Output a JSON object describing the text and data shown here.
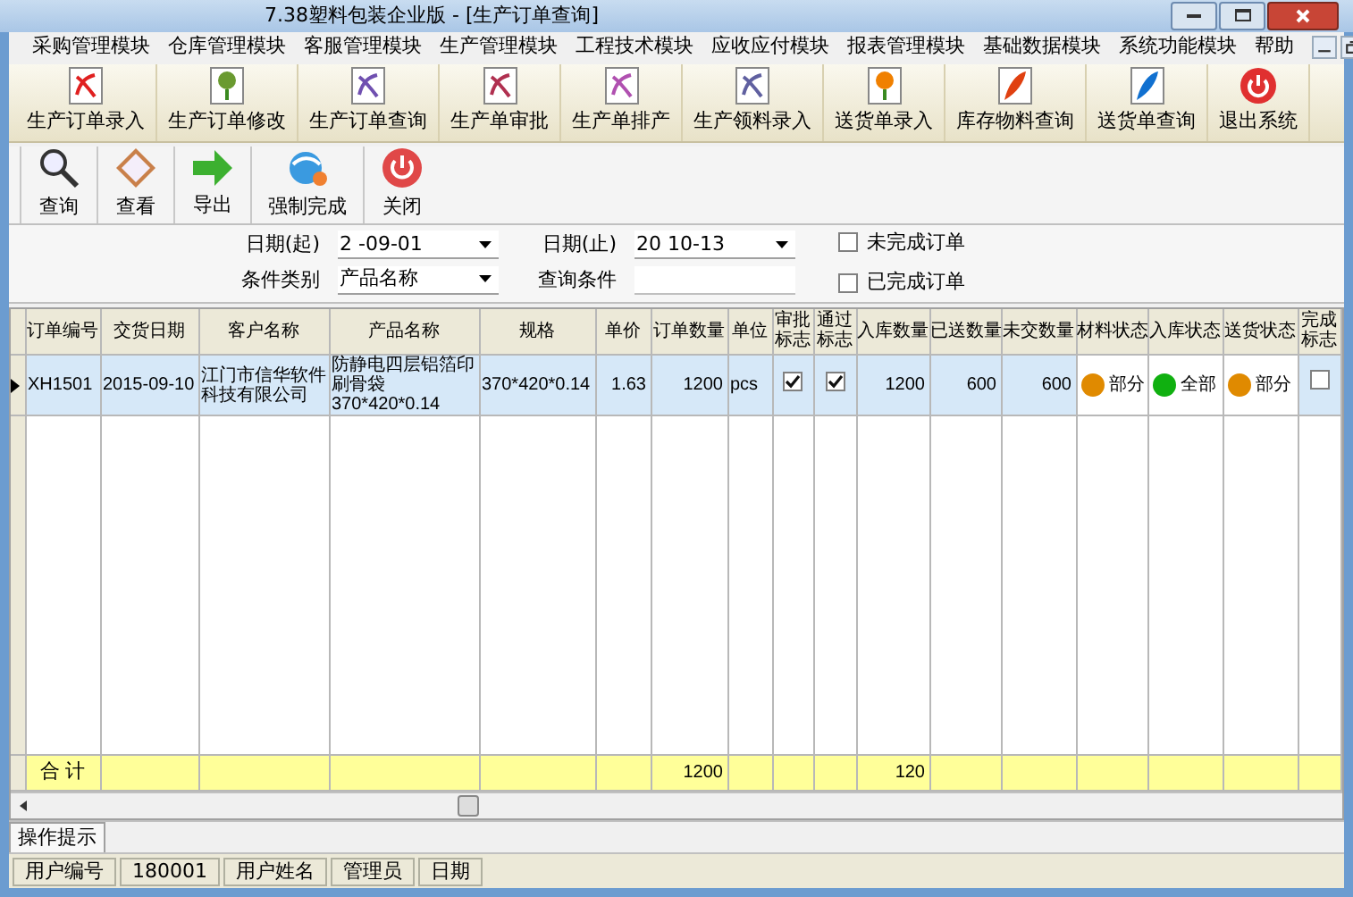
{
  "window": {
    "title": "7.38塑料包装企业版 - [生产订单查询]"
  },
  "menu": [
    {
      "label": "采购管理模块"
    },
    {
      "label": "仓库管理模块"
    },
    {
      "label": "客服管理模块"
    },
    {
      "label": "生产管理模块"
    },
    {
      "label": "工程技术模块"
    },
    {
      "label": "应收应付模块"
    },
    {
      "label": "报表管理模块"
    },
    {
      "label": "基础数据模块"
    },
    {
      "label": "系统功能模块"
    },
    {
      "label": "帮助"
    }
  ],
  "module_toolbar": [
    {
      "label": "生产订单录入"
    },
    {
      "label": "生产订单修改"
    },
    {
      "label": "生产订单查询"
    },
    {
      "label": "生产单审批"
    },
    {
      "label": "生产单排产"
    },
    {
      "label": "生产领料录入"
    },
    {
      "label": "送货单录入"
    },
    {
      "label": "库存物料查询"
    },
    {
      "label": "送货单查询"
    },
    {
      "label": "退出系统"
    }
  ],
  "action_toolbar": [
    {
      "label": "查询"
    },
    {
      "label": "查看"
    },
    {
      "label": "导出"
    },
    {
      "label": "强制完成"
    },
    {
      "label": "关闭"
    }
  ],
  "filters": {
    "date_from": {
      "label": "日期(起)",
      "value": "2 -09-01"
    },
    "date_to": {
      "label": "日期(止)",
      "value": "20 10-13"
    },
    "category": {
      "label": "条件类别",
      "value": "产品名称"
    },
    "query": {
      "label": "查询条件"
    },
    "unfinished": {
      "label": "未完成订单",
      "checked": false
    },
    "finished": {
      "label": "已完成订单",
      "checked": false
    }
  },
  "table": {
    "columns": [
      "订单编号",
      "交货日期",
      "客户名称",
      "产品名称",
      "规格",
      "单价",
      "订单数量",
      "单位",
      "审批标志",
      "通过标志",
      "入库数量",
      "已送数量",
      "未交数量",
      "材料状态",
      "入库状态",
      "送货状态",
      "完成标志"
    ],
    "rows": [
      {
        "selected": true,
        "cells": [
          {
            "kind": "text",
            "text": "XH1501"
          },
          {
            "kind": "text",
            "text": "2015-09-10"
          },
          {
            "kind": "text",
            "text": "江门市信华软件科技有限公司"
          },
          {
            "kind": "text",
            "text": "防静电四层铝箔印刷骨袋　370*420*0.14"
          },
          {
            "kind": "text",
            "text": "370*420*0.14"
          },
          {
            "kind": "number",
            "text": "1.63"
          },
          {
            "kind": "number",
            "text": "1200"
          },
          {
            "kind": "text",
            "text": "pcs"
          },
          {
            "kind": "check",
            "checked": true
          },
          {
            "kind": "check",
            "checked": true
          },
          {
            "kind": "number",
            "text": "1200"
          },
          {
            "kind": "number",
            "text": "600"
          },
          {
            "kind": "number",
            "text": "600"
          },
          {
            "kind": "status",
            "text": "部分",
            "color": "#e08a00"
          },
          {
            "kind": "status",
            "text": "全部",
            "color": "#10b010"
          },
          {
            "kind": "status",
            "text": "部分",
            "color": "#e08a00"
          },
          {
            "kind": "check",
            "checked": false
          }
        ]
      }
    ],
    "summary": {
      "cells": [
        {
          "kind": "label",
          "text": "合 计"
        },
        {
          "kind": "empty"
        },
        {
          "kind": "empty"
        },
        {
          "kind": "empty"
        },
        {
          "kind": "empty"
        },
        {
          "kind": "empty"
        },
        {
          "kind": "number",
          "text": "1200"
        },
        {
          "kind": "empty"
        },
        {
          "kind": "empty"
        },
        {
          "kind": "empty"
        },
        {
          "kind": "number",
          "text": "120"
        },
        {
          "kind": "empty"
        },
        {
          "kind": "empty"
        },
        {
          "kind": "empty"
        },
        {
          "kind": "empty"
        },
        {
          "kind": "empty"
        },
        {
          "kind": "empty"
        }
      ]
    }
  },
  "tip_tab": {
    "label": "操作提示"
  },
  "status_bar": [
    {
      "text": "用户编号"
    },
    {
      "text": "180001"
    },
    {
      "text": "用户姓名"
    },
    {
      "text": "管理员"
    },
    {
      "text": "日期"
    }
  ]
}
